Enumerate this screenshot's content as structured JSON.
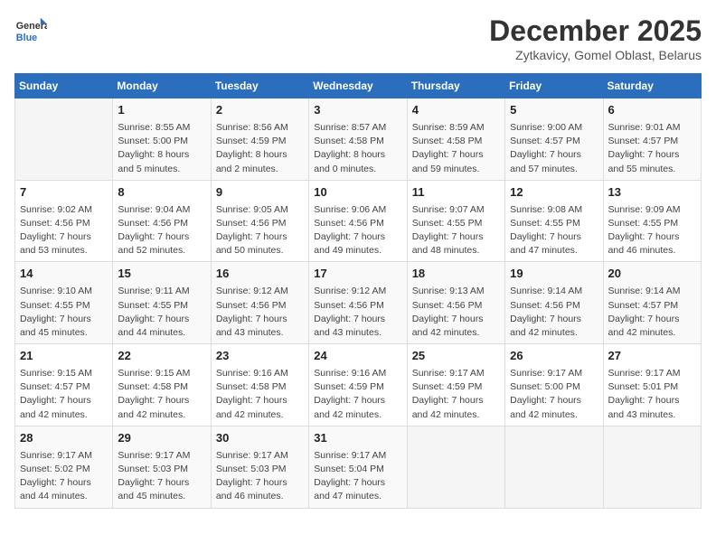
{
  "header": {
    "logo_line1": "General",
    "logo_line2": "Blue",
    "month": "December 2025",
    "location": "Zytkavicy, Gomel Oblast, Belarus"
  },
  "weekdays": [
    "Sunday",
    "Monday",
    "Tuesday",
    "Wednesday",
    "Thursday",
    "Friday",
    "Saturday"
  ],
  "weeks": [
    [
      {
        "day": "",
        "info": ""
      },
      {
        "day": "1",
        "info": "Sunrise: 8:55 AM\nSunset: 5:00 PM\nDaylight: 8 hours\nand 5 minutes."
      },
      {
        "day": "2",
        "info": "Sunrise: 8:56 AM\nSunset: 4:59 PM\nDaylight: 8 hours\nand 2 minutes."
      },
      {
        "day": "3",
        "info": "Sunrise: 8:57 AM\nSunset: 4:58 PM\nDaylight: 8 hours\nand 0 minutes."
      },
      {
        "day": "4",
        "info": "Sunrise: 8:59 AM\nSunset: 4:58 PM\nDaylight: 7 hours\nand 59 minutes."
      },
      {
        "day": "5",
        "info": "Sunrise: 9:00 AM\nSunset: 4:57 PM\nDaylight: 7 hours\nand 57 minutes."
      },
      {
        "day": "6",
        "info": "Sunrise: 9:01 AM\nSunset: 4:57 PM\nDaylight: 7 hours\nand 55 minutes."
      }
    ],
    [
      {
        "day": "7",
        "info": "Sunrise: 9:02 AM\nSunset: 4:56 PM\nDaylight: 7 hours\nand 53 minutes."
      },
      {
        "day": "8",
        "info": "Sunrise: 9:04 AM\nSunset: 4:56 PM\nDaylight: 7 hours\nand 52 minutes."
      },
      {
        "day": "9",
        "info": "Sunrise: 9:05 AM\nSunset: 4:56 PM\nDaylight: 7 hours\nand 50 minutes."
      },
      {
        "day": "10",
        "info": "Sunrise: 9:06 AM\nSunset: 4:56 PM\nDaylight: 7 hours\nand 49 minutes."
      },
      {
        "day": "11",
        "info": "Sunrise: 9:07 AM\nSunset: 4:55 PM\nDaylight: 7 hours\nand 48 minutes."
      },
      {
        "day": "12",
        "info": "Sunrise: 9:08 AM\nSunset: 4:55 PM\nDaylight: 7 hours\nand 47 minutes."
      },
      {
        "day": "13",
        "info": "Sunrise: 9:09 AM\nSunset: 4:55 PM\nDaylight: 7 hours\nand 46 minutes."
      }
    ],
    [
      {
        "day": "14",
        "info": "Sunrise: 9:10 AM\nSunset: 4:55 PM\nDaylight: 7 hours\nand 45 minutes."
      },
      {
        "day": "15",
        "info": "Sunrise: 9:11 AM\nSunset: 4:55 PM\nDaylight: 7 hours\nand 44 minutes."
      },
      {
        "day": "16",
        "info": "Sunrise: 9:12 AM\nSunset: 4:56 PM\nDaylight: 7 hours\nand 43 minutes."
      },
      {
        "day": "17",
        "info": "Sunrise: 9:12 AM\nSunset: 4:56 PM\nDaylight: 7 hours\nand 43 minutes."
      },
      {
        "day": "18",
        "info": "Sunrise: 9:13 AM\nSunset: 4:56 PM\nDaylight: 7 hours\nand 42 minutes."
      },
      {
        "day": "19",
        "info": "Sunrise: 9:14 AM\nSunset: 4:56 PM\nDaylight: 7 hours\nand 42 minutes."
      },
      {
        "day": "20",
        "info": "Sunrise: 9:14 AM\nSunset: 4:57 PM\nDaylight: 7 hours\nand 42 minutes."
      }
    ],
    [
      {
        "day": "21",
        "info": "Sunrise: 9:15 AM\nSunset: 4:57 PM\nDaylight: 7 hours\nand 42 minutes."
      },
      {
        "day": "22",
        "info": "Sunrise: 9:15 AM\nSunset: 4:58 PM\nDaylight: 7 hours\nand 42 minutes."
      },
      {
        "day": "23",
        "info": "Sunrise: 9:16 AM\nSunset: 4:58 PM\nDaylight: 7 hours\nand 42 minutes."
      },
      {
        "day": "24",
        "info": "Sunrise: 9:16 AM\nSunset: 4:59 PM\nDaylight: 7 hours\nand 42 minutes."
      },
      {
        "day": "25",
        "info": "Sunrise: 9:17 AM\nSunset: 4:59 PM\nDaylight: 7 hours\nand 42 minutes."
      },
      {
        "day": "26",
        "info": "Sunrise: 9:17 AM\nSunset: 5:00 PM\nDaylight: 7 hours\nand 42 minutes."
      },
      {
        "day": "27",
        "info": "Sunrise: 9:17 AM\nSunset: 5:01 PM\nDaylight: 7 hours\nand 43 minutes."
      }
    ],
    [
      {
        "day": "28",
        "info": "Sunrise: 9:17 AM\nSunset: 5:02 PM\nDaylight: 7 hours\nand 44 minutes."
      },
      {
        "day": "29",
        "info": "Sunrise: 9:17 AM\nSunset: 5:03 PM\nDaylight: 7 hours\nand 45 minutes."
      },
      {
        "day": "30",
        "info": "Sunrise: 9:17 AM\nSunset: 5:03 PM\nDaylight: 7 hours\nand 46 minutes."
      },
      {
        "day": "31",
        "info": "Sunrise: 9:17 AM\nSunset: 5:04 PM\nDaylight: 7 hours\nand 47 minutes."
      },
      {
        "day": "",
        "info": ""
      },
      {
        "day": "",
        "info": ""
      },
      {
        "day": "",
        "info": ""
      }
    ]
  ]
}
